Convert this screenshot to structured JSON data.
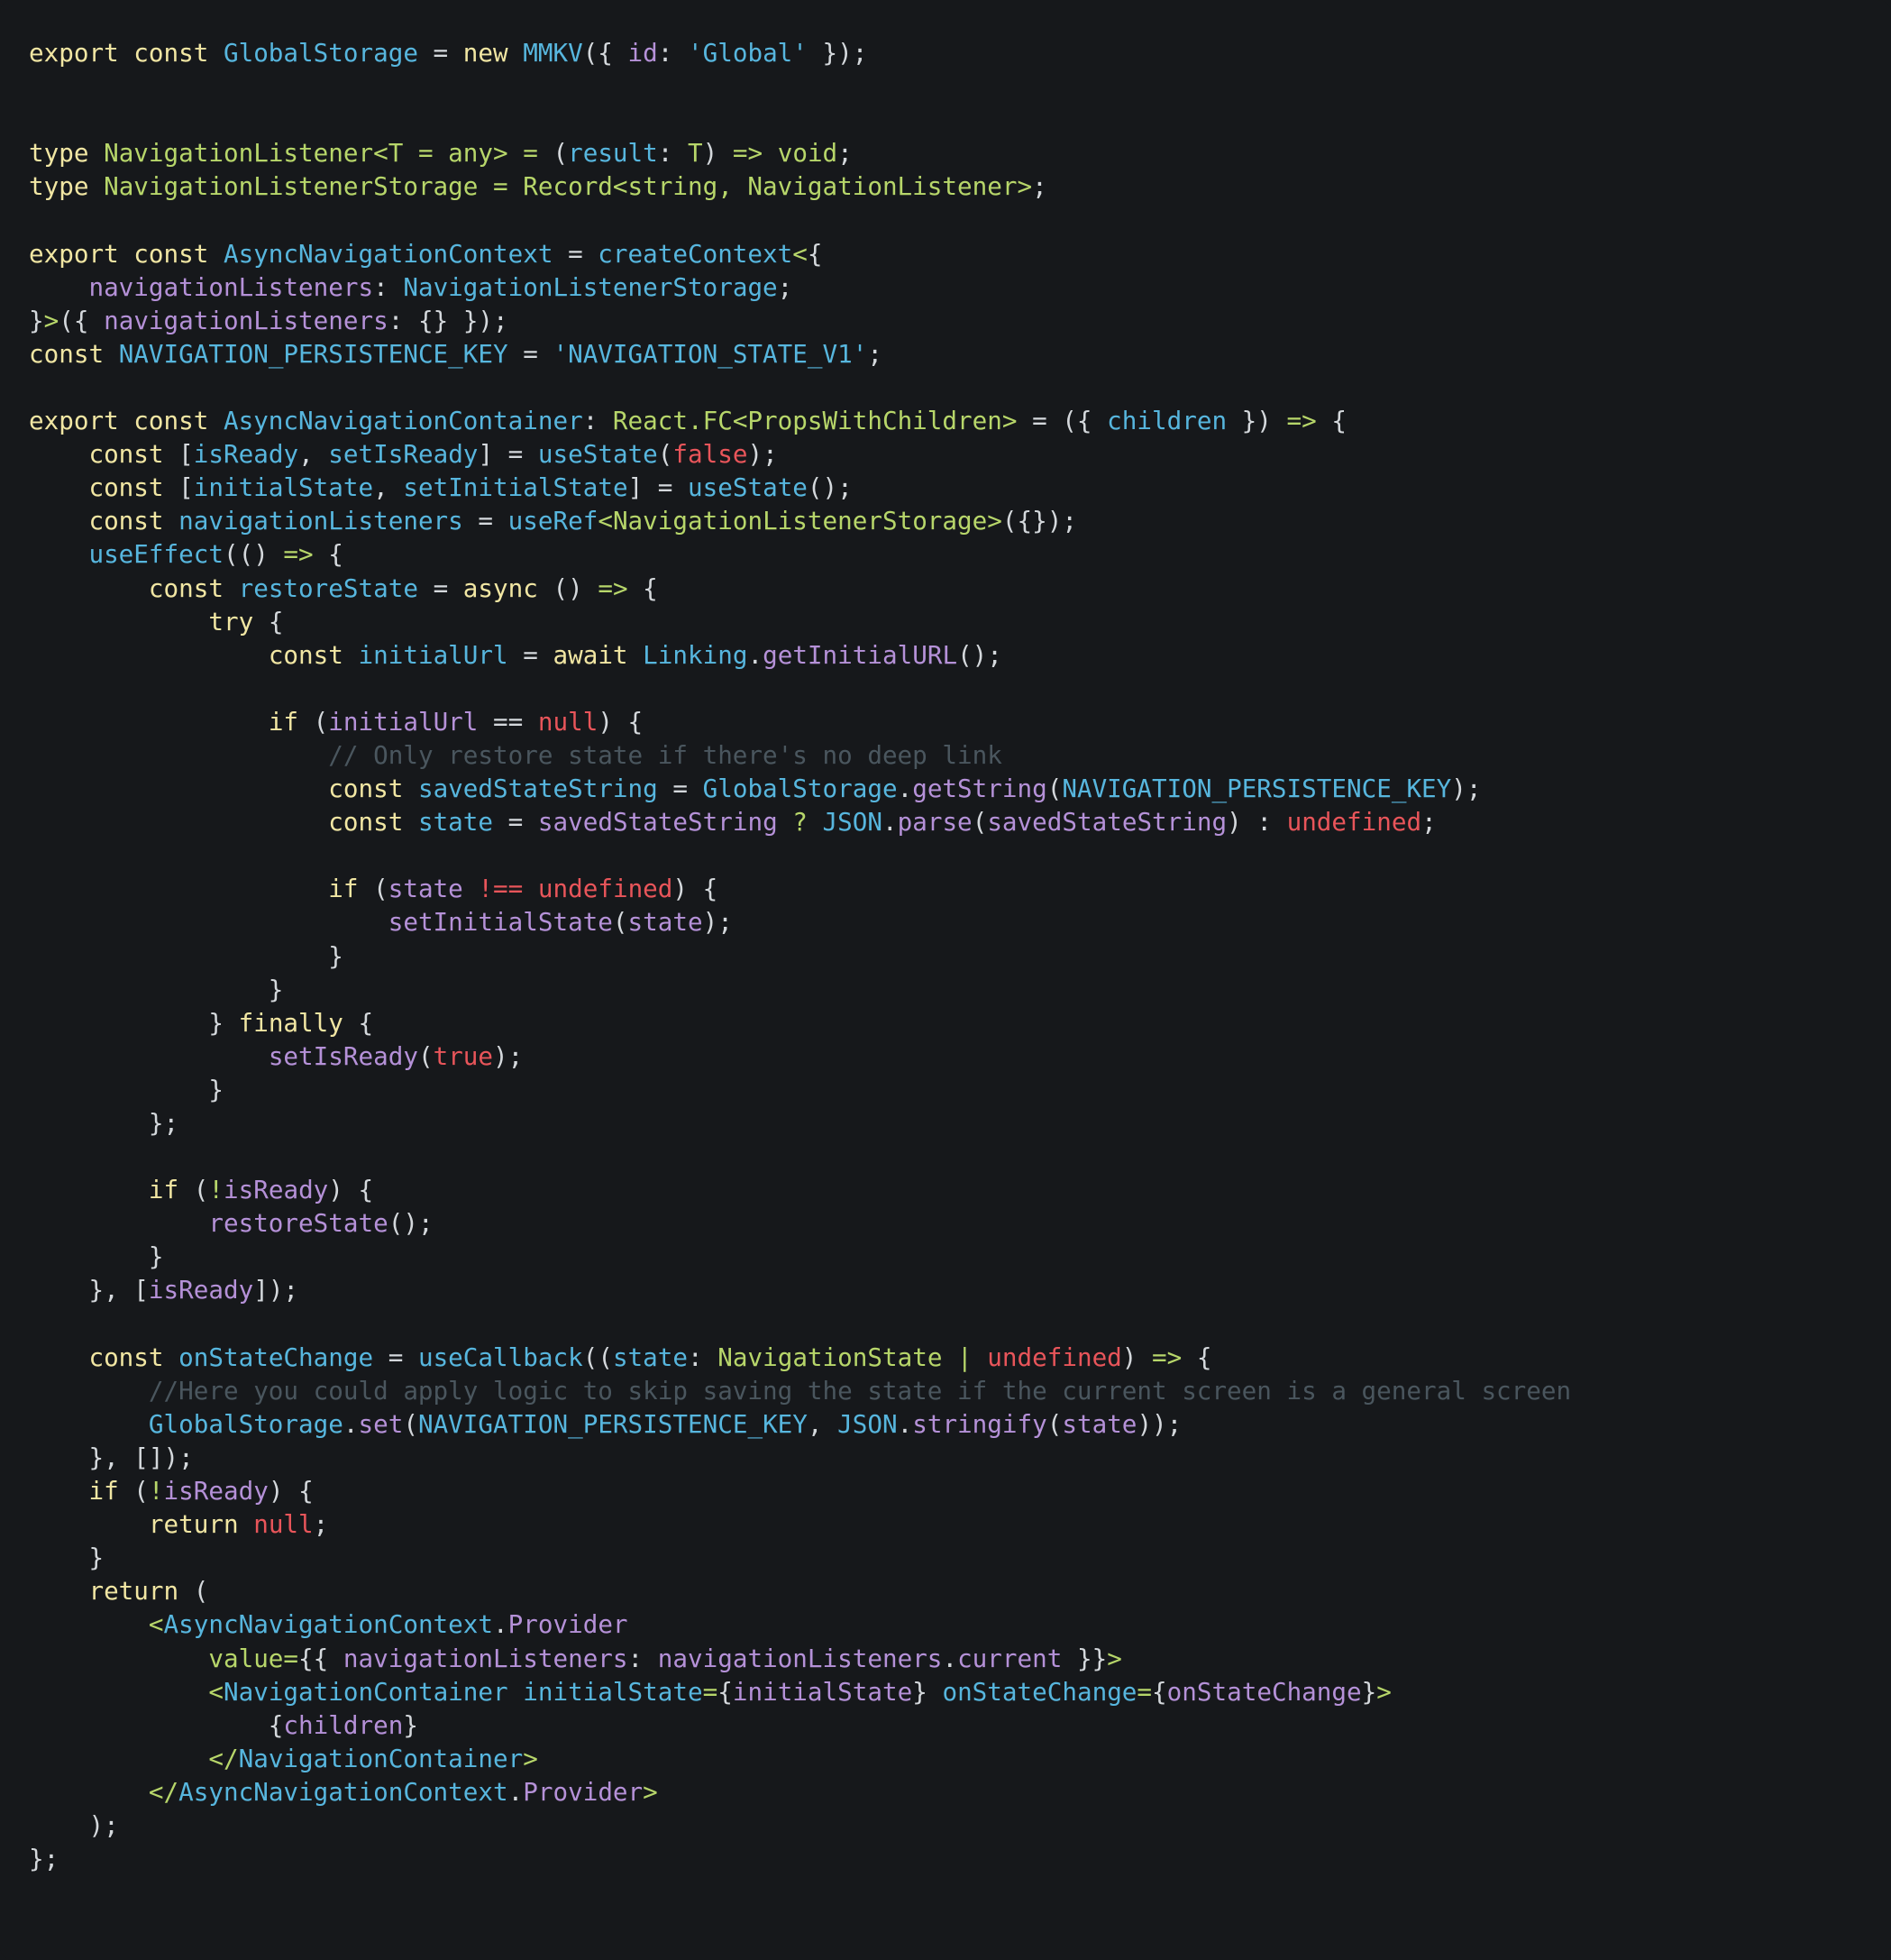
{
  "colors": {
    "background": "#16181b",
    "keyword": "#f1e6a3",
    "identifier": "#57b6de",
    "type": "#b7d66a",
    "property": "#b591d8",
    "string": "#57b6de",
    "literal": "#e8555a",
    "comment": "#4a565e",
    "punctuation": "#d4d8dc"
  },
  "code": {
    "lines": [
      [
        [
          "kw",
          "export const "
        ],
        [
          "id",
          "GlobalStorage"
        ],
        [
          "pu",
          " = "
        ],
        [
          "kw",
          "new "
        ],
        [
          "id",
          "MMKV"
        ],
        [
          "pu",
          "({ "
        ],
        [
          "pr",
          "id"
        ],
        [
          "pu",
          ": "
        ],
        [
          "st",
          "'Global'"
        ],
        [
          "pu",
          " });"
        ]
      ],
      [],
      [],
      [
        [
          "kw",
          "type "
        ],
        [
          "ty",
          "NavigationListener<T = any> = "
        ],
        [
          "pu",
          "("
        ],
        [
          "id",
          "result"
        ],
        [
          "pu",
          ": "
        ],
        [
          "ty",
          "T"
        ],
        [
          "pu",
          ") "
        ],
        [
          "ty",
          "=> void"
        ],
        [
          "pu",
          ";"
        ]
      ],
      [
        [
          "kw",
          "type "
        ],
        [
          "ty",
          "NavigationListenerStorage = Record<string, NavigationListener>"
        ],
        [
          "pu",
          ";"
        ]
      ],
      [],
      [
        [
          "kw",
          "export const "
        ],
        [
          "id",
          "AsyncNavigationContext"
        ],
        [
          "pu",
          " = "
        ],
        [
          "id",
          "createContext"
        ],
        [
          "ty",
          "<"
        ],
        [
          "pu",
          "{"
        ]
      ],
      [
        [
          "pu",
          "    "
        ],
        [
          "pr",
          "navigationListeners"
        ],
        [
          "pu",
          ": "
        ],
        [
          "id",
          "NavigationListenerStorage"
        ],
        [
          "pu",
          ";"
        ]
      ],
      [
        [
          "pu",
          "}"
        ],
        [
          "ty",
          ">"
        ],
        [
          "pu",
          "({ "
        ],
        [
          "pr",
          "navigationListeners"
        ],
        [
          "pu",
          ": {} });"
        ]
      ],
      [
        [
          "kw",
          "const "
        ],
        [
          "id",
          "NAVIGATION_PERSISTENCE_KEY"
        ],
        [
          "pu",
          " = "
        ],
        [
          "st",
          "'NAVIGATION_STATE_V1'"
        ],
        [
          "pu",
          ";"
        ]
      ],
      [],
      [
        [
          "kw",
          "export const "
        ],
        [
          "id",
          "AsyncNavigationContainer"
        ],
        [
          "pu",
          ": "
        ],
        [
          "ty",
          "React.FC<PropsWithChildren>"
        ],
        [
          "pu",
          " = ({ "
        ],
        [
          "id",
          "children"
        ],
        [
          "pu",
          " }) "
        ],
        [
          "ty",
          "=>"
        ],
        [
          "pu",
          " {"
        ]
      ],
      [
        [
          "pu",
          "    "
        ],
        [
          "kw",
          "const "
        ],
        [
          "pu",
          "["
        ],
        [
          "id",
          "isReady"
        ],
        [
          "pu",
          ", "
        ],
        [
          "id",
          "setIsReady"
        ],
        [
          "pu",
          "] = "
        ],
        [
          "id",
          "useState"
        ],
        [
          "pu",
          "("
        ],
        [
          "lit",
          "false"
        ],
        [
          "pu",
          ");"
        ]
      ],
      [
        [
          "pu",
          "    "
        ],
        [
          "kw",
          "const "
        ],
        [
          "pu",
          "["
        ],
        [
          "id",
          "initialState"
        ],
        [
          "pu",
          ", "
        ],
        [
          "id",
          "setInitialState"
        ],
        [
          "pu",
          "] = "
        ],
        [
          "id",
          "useState"
        ],
        [
          "pu",
          "();"
        ]
      ],
      [
        [
          "pu",
          "    "
        ],
        [
          "kw",
          "const "
        ],
        [
          "id",
          "navigationListeners"
        ],
        [
          "pu",
          " = "
        ],
        [
          "id",
          "useRef"
        ],
        [
          "ty",
          "<NavigationListenerStorage>"
        ],
        [
          "pu",
          "({});"
        ]
      ],
      [
        [
          "pu",
          "    "
        ],
        [
          "id",
          "useEffect"
        ],
        [
          "pu",
          "(() "
        ],
        [
          "ty",
          "=>"
        ],
        [
          "pu",
          " {"
        ]
      ],
      [
        [
          "pu",
          "        "
        ],
        [
          "kw",
          "const "
        ],
        [
          "id",
          "restoreState"
        ],
        [
          "pu",
          " = "
        ],
        [
          "kw",
          "async "
        ],
        [
          "pu",
          "() "
        ],
        [
          "ty",
          "=>"
        ],
        [
          "pu",
          " {"
        ]
      ],
      [
        [
          "pu",
          "            "
        ],
        [
          "kw",
          "try "
        ],
        [
          "pu",
          "{"
        ]
      ],
      [
        [
          "pu",
          "                "
        ],
        [
          "kw",
          "const "
        ],
        [
          "id",
          "initialUrl"
        ],
        [
          "pu",
          " = "
        ],
        [
          "kw",
          "await "
        ],
        [
          "id",
          "Linking"
        ],
        [
          "pu",
          "."
        ],
        [
          "pr",
          "getInitialURL"
        ],
        [
          "pu",
          "();"
        ]
      ],
      [],
      [
        [
          "pu",
          "                "
        ],
        [
          "kw",
          "if "
        ],
        [
          "pu",
          "("
        ],
        [
          "pr",
          "initialUrl"
        ],
        [
          "pu",
          " == "
        ],
        [
          "lit",
          "null"
        ],
        [
          "pu",
          ") {"
        ]
      ],
      [
        [
          "pu",
          "                    "
        ],
        [
          "cm",
          "// Only restore state if there's no deep link"
        ]
      ],
      [
        [
          "pu",
          "                    "
        ],
        [
          "kw",
          "const "
        ],
        [
          "id",
          "savedStateString"
        ],
        [
          "pu",
          " = "
        ],
        [
          "id",
          "GlobalStorage"
        ],
        [
          "pu",
          "."
        ],
        [
          "pr",
          "getString"
        ],
        [
          "pu",
          "("
        ],
        [
          "id",
          "NAVIGATION_PERSISTENCE_KEY"
        ],
        [
          "pu",
          ");"
        ]
      ],
      [
        [
          "pu",
          "                    "
        ],
        [
          "kw",
          "const "
        ],
        [
          "id",
          "state"
        ],
        [
          "pu",
          " = "
        ],
        [
          "pr",
          "savedStateString"
        ],
        [
          "ty",
          " ? "
        ],
        [
          "id",
          "JSON"
        ],
        [
          "pu",
          "."
        ],
        [
          "pr",
          "parse"
        ],
        [
          "pu",
          "("
        ],
        [
          "pr",
          "savedStateString"
        ],
        [
          "pu",
          ") : "
        ],
        [
          "lit",
          "undefined"
        ],
        [
          "pu",
          ";"
        ]
      ],
      [],
      [
        [
          "pu",
          "                    "
        ],
        [
          "kw",
          "if "
        ],
        [
          "pu",
          "("
        ],
        [
          "pr",
          "state"
        ],
        [
          "lit",
          " !== "
        ],
        [
          "lit",
          "undefined"
        ],
        [
          "pu",
          ") {"
        ]
      ],
      [
        [
          "pu",
          "                        "
        ],
        [
          "pr",
          "setInitialState"
        ],
        [
          "pu",
          "("
        ],
        [
          "pr",
          "state"
        ],
        [
          "pu",
          ");"
        ]
      ],
      [
        [
          "pu",
          "                    }"
        ]
      ],
      [
        [
          "pu",
          "                }"
        ]
      ],
      [
        [
          "pu",
          "            } "
        ],
        [
          "kw",
          "finally "
        ],
        [
          "pu",
          "{"
        ]
      ],
      [
        [
          "pu",
          "                "
        ],
        [
          "pr",
          "setIsReady"
        ],
        [
          "pu",
          "("
        ],
        [
          "lit",
          "true"
        ],
        [
          "pu",
          ");"
        ]
      ],
      [
        [
          "pu",
          "            }"
        ]
      ],
      [
        [
          "pu",
          "        };"
        ]
      ],
      [],
      [
        [
          "pu",
          "        "
        ],
        [
          "kw",
          "if "
        ],
        [
          "pu",
          "("
        ],
        [
          "ty",
          "!"
        ],
        [
          "pr",
          "isReady"
        ],
        [
          "pu",
          ") {"
        ]
      ],
      [
        [
          "pu",
          "            "
        ],
        [
          "pr",
          "restoreState"
        ],
        [
          "pu",
          "();"
        ]
      ],
      [
        [
          "pu",
          "        }"
        ]
      ],
      [
        [
          "pu",
          "    }, ["
        ],
        [
          "pr",
          "isReady"
        ],
        [
          "pu",
          "]);"
        ]
      ],
      [],
      [
        [
          "pu",
          "    "
        ],
        [
          "kw",
          "const "
        ],
        [
          "id",
          "onStateChange"
        ],
        [
          "pu",
          " = "
        ],
        [
          "id",
          "useCallback"
        ],
        [
          "pu",
          "(("
        ],
        [
          "id",
          "state"
        ],
        [
          "pu",
          ": "
        ],
        [
          "ty",
          "NavigationState | "
        ],
        [
          "lit",
          "undefined"
        ],
        [
          "pu",
          ") "
        ],
        [
          "ty",
          "=>"
        ],
        [
          "pu",
          " {"
        ]
      ],
      [
        [
          "pu",
          "        "
        ],
        [
          "cm",
          "//Here you could apply logic to skip saving the state if the current screen is a general screen"
        ]
      ],
      [
        [
          "pu",
          "        "
        ],
        [
          "id",
          "GlobalStorage"
        ],
        [
          "pu",
          "."
        ],
        [
          "pr",
          "set"
        ],
        [
          "pu",
          "("
        ],
        [
          "id",
          "NAVIGATION_PERSISTENCE_KEY"
        ],
        [
          "pu",
          ", "
        ],
        [
          "id",
          "JSON"
        ],
        [
          "pu",
          "."
        ],
        [
          "pr",
          "stringify"
        ],
        [
          "pu",
          "("
        ],
        [
          "pr",
          "state"
        ],
        [
          "pu",
          "));"
        ]
      ],
      [
        [
          "pu",
          "    }, []);"
        ]
      ],
      [
        [
          "pu",
          "    "
        ],
        [
          "kw",
          "if "
        ],
        [
          "pu",
          "("
        ],
        [
          "ty",
          "!"
        ],
        [
          "pr",
          "isReady"
        ],
        [
          "pu",
          ") {"
        ]
      ],
      [
        [
          "pu",
          "        "
        ],
        [
          "kw",
          "return "
        ],
        [
          "lit",
          "null"
        ],
        [
          "pu",
          ";"
        ]
      ],
      [
        [
          "pu",
          "    }"
        ]
      ],
      [
        [
          "pu",
          "    "
        ],
        [
          "kw",
          "return "
        ],
        [
          "pu",
          "("
        ]
      ],
      [
        [
          "pu",
          "        "
        ],
        [
          "ty",
          "<"
        ],
        [
          "id",
          "AsyncNavigationContext"
        ],
        [
          "pu",
          "."
        ],
        [
          "pr",
          "Provider"
        ]
      ],
      [
        [
          "pu",
          "            "
        ],
        [
          "ty",
          "value="
        ],
        [
          "pu",
          "{{ "
        ],
        [
          "pr",
          "navigationListeners"
        ],
        [
          "pu",
          ": "
        ],
        [
          "pr",
          "navigationListeners"
        ],
        [
          "pu",
          "."
        ],
        [
          "pr",
          "current"
        ],
        [
          "pu",
          " }}"
        ],
        [
          "ty",
          ">"
        ]
      ],
      [
        [
          "pu",
          "            "
        ],
        [
          "ty",
          "<"
        ],
        [
          "id",
          "NavigationContainer initialState"
        ],
        [
          "ty",
          "="
        ],
        [
          "pu",
          "{"
        ],
        [
          "pr",
          "initialState"
        ],
        [
          "pu",
          "} "
        ],
        [
          "id",
          "onStateChange"
        ],
        [
          "ty",
          "="
        ],
        [
          "pu",
          "{"
        ],
        [
          "pr",
          "onStateChange"
        ],
        [
          "pu",
          "}"
        ],
        [
          "ty",
          ">"
        ]
      ],
      [
        [
          "pu",
          "                {"
        ],
        [
          "pr",
          "children"
        ],
        [
          "pu",
          "}"
        ]
      ],
      [
        [
          "pu",
          "            "
        ],
        [
          "ty",
          "</"
        ],
        [
          "id",
          "NavigationContainer"
        ],
        [
          "ty",
          ">"
        ]
      ],
      [
        [
          "pu",
          "        "
        ],
        [
          "ty",
          "</"
        ],
        [
          "id",
          "AsyncNavigationContext"
        ],
        [
          "pu",
          "."
        ],
        [
          "pr",
          "Provider"
        ],
        [
          "ty",
          ">"
        ]
      ],
      [
        [
          "pu",
          "    );"
        ]
      ],
      [
        [
          "pu",
          "};"
        ]
      ]
    ]
  }
}
